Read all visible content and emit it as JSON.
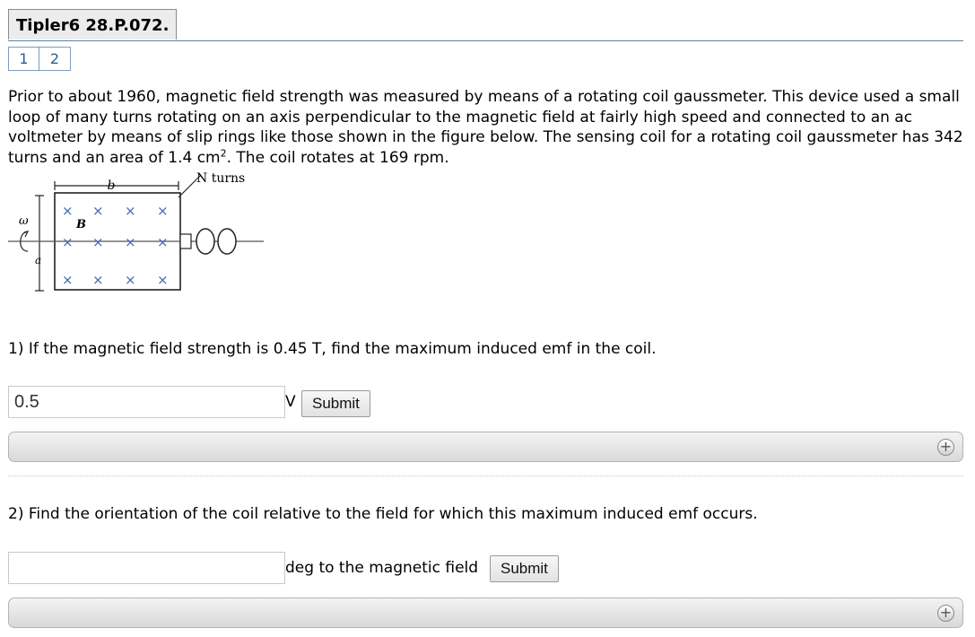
{
  "header": {
    "title": "Tipler6 28.P.072."
  },
  "pager": {
    "pages": [
      "1",
      "2"
    ]
  },
  "problem": {
    "text_before_sup": "Prior to about 1960, magnetic field strength was measured by means of a rotating coil gaussmeter. This device used a small loop of many turns rotating on an axis perpendicular to the magnetic field at fairly high speed and connected to an ac voltmeter by means of slip rings like those shown in the figure below. The sensing coil for a rotating coil gaussmeter has 342 turns and an area of 1.4 cm",
    "sup": "2",
    "text_after_sup": ". The coil rotates at 169 rpm."
  },
  "figure": {
    "label_b": "b",
    "label_n_turns": "N turns",
    "label_B": "B",
    "label_omega": "ω",
    "label_a": "a"
  },
  "questions": [
    {
      "prompt": "1) If the magnetic field strength is 0.45 T, find the maximum induced emf in the coil.",
      "value": "0.5",
      "unit": "V",
      "submit_label": "Submit"
    },
    {
      "prompt": "2) Find the orientation of the coil relative to the field for which this maximum induced emf occurs.",
      "value": "",
      "unit": "deg to the magnetic field",
      "submit_label": "Submit"
    }
  ],
  "icons": {
    "expand": "plus-circle-icon"
  }
}
